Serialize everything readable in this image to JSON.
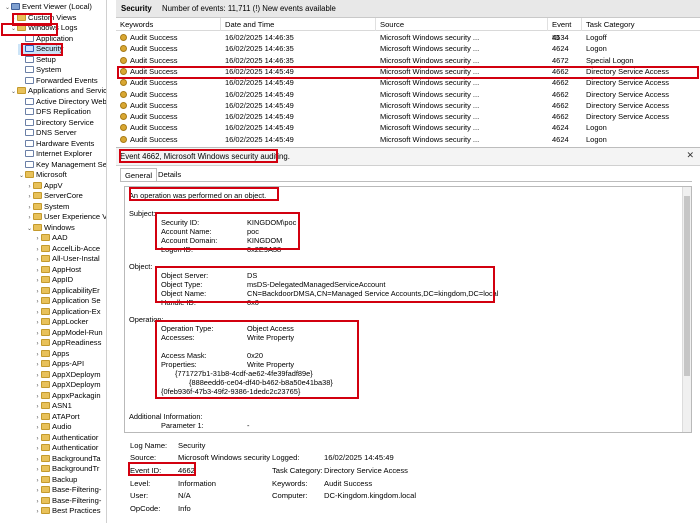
{
  "tree": {
    "items": [
      {
        "label": "Event Viewer (Local)",
        "icon": "root",
        "depth": 0,
        "exp": "⌄"
      },
      {
        "label": "Custom Views",
        "icon": "folder",
        "depth": 1,
        "exp": "›"
      },
      {
        "label": "Windows Logs",
        "icon": "folder",
        "depth": 1,
        "exp": "⌄"
      },
      {
        "label": "Application",
        "icon": "log",
        "depth": 2,
        "exp": ""
      },
      {
        "label": "Security",
        "icon": "logsel",
        "depth": 2,
        "exp": "",
        "selected": true
      },
      {
        "label": "Setup",
        "icon": "log",
        "depth": 2,
        "exp": ""
      },
      {
        "label": "System",
        "icon": "log",
        "depth": 2,
        "exp": ""
      },
      {
        "label": "Forwarded Events",
        "icon": "log",
        "depth": 2,
        "exp": ""
      },
      {
        "label": "Applications and Services Logs",
        "icon": "folder",
        "depth": 1,
        "exp": "⌄"
      },
      {
        "label": "Active Directory Web",
        "icon": "log",
        "depth": 2,
        "exp": ""
      },
      {
        "label": "DFS Replication",
        "icon": "log",
        "depth": 2,
        "exp": ""
      },
      {
        "label": "Directory Service",
        "icon": "log",
        "depth": 2,
        "exp": ""
      },
      {
        "label": "DNS Server",
        "icon": "log",
        "depth": 2,
        "exp": ""
      },
      {
        "label": "Hardware Events",
        "icon": "log",
        "depth": 2,
        "exp": ""
      },
      {
        "label": "Internet Explorer",
        "icon": "log",
        "depth": 2,
        "exp": ""
      },
      {
        "label": "Key Management Ser",
        "icon": "log",
        "depth": 2,
        "exp": ""
      },
      {
        "label": "Microsoft",
        "icon": "folder",
        "depth": 2,
        "exp": "⌄"
      },
      {
        "label": "AppV",
        "icon": "folder",
        "depth": 3,
        "exp": "›"
      },
      {
        "label": "ServerCore",
        "icon": "folder",
        "depth": 3,
        "exp": "›"
      },
      {
        "label": "System",
        "icon": "folder",
        "depth": 3,
        "exp": "›"
      },
      {
        "label": "User Experience Vi",
        "icon": "folder",
        "depth": 3,
        "exp": "›"
      },
      {
        "label": "Windows",
        "icon": "folder",
        "depth": 3,
        "exp": "⌄"
      },
      {
        "label": "AAD",
        "icon": "folder",
        "depth": 4,
        "exp": "›"
      },
      {
        "label": "AccelLib-Acce",
        "icon": "folder",
        "depth": 4,
        "exp": "›"
      },
      {
        "label": "All-User-Instal",
        "icon": "folder",
        "depth": 4,
        "exp": "›"
      },
      {
        "label": "AppHost",
        "icon": "folder",
        "depth": 4,
        "exp": "›"
      },
      {
        "label": "AppID",
        "icon": "folder",
        "depth": 4,
        "exp": "›"
      },
      {
        "label": "ApplicabilityEr",
        "icon": "folder",
        "depth": 4,
        "exp": "›"
      },
      {
        "label": "Application Se",
        "icon": "folder",
        "depth": 4,
        "exp": "›"
      },
      {
        "label": "Application-Ex",
        "icon": "folder",
        "depth": 4,
        "exp": "›"
      },
      {
        "label": "AppLocker",
        "icon": "folder",
        "depth": 4,
        "exp": "›"
      },
      {
        "label": "AppModel-Run",
        "icon": "folder",
        "depth": 4,
        "exp": "›"
      },
      {
        "label": "AppReadiness",
        "icon": "folder",
        "depth": 4,
        "exp": "›"
      },
      {
        "label": "Apps",
        "icon": "folder",
        "depth": 4,
        "exp": "›"
      },
      {
        "label": "Apps-API",
        "icon": "folder",
        "depth": 4,
        "exp": "›"
      },
      {
        "label": "AppXDeploym",
        "icon": "folder",
        "depth": 4,
        "exp": "›"
      },
      {
        "label": "AppXDeploym",
        "icon": "folder",
        "depth": 4,
        "exp": "›"
      },
      {
        "label": "AppxPackagin",
        "icon": "folder",
        "depth": 4,
        "exp": "›"
      },
      {
        "label": "ASN1",
        "icon": "folder",
        "depth": 4,
        "exp": "›"
      },
      {
        "label": "ATAPort",
        "icon": "folder",
        "depth": 4,
        "exp": "›"
      },
      {
        "label": "Audio",
        "icon": "folder",
        "depth": 4,
        "exp": "›"
      },
      {
        "label": "Authenticatior",
        "icon": "folder",
        "depth": 4,
        "exp": "›"
      },
      {
        "label": "Authenticatior",
        "icon": "folder",
        "depth": 4,
        "exp": "›"
      },
      {
        "label": "BackgroundTa",
        "icon": "folder",
        "depth": 4,
        "exp": "›"
      },
      {
        "label": "BackgroundTr",
        "icon": "folder",
        "depth": 4,
        "exp": "›"
      },
      {
        "label": "Backup",
        "icon": "folder",
        "depth": 4,
        "exp": "›"
      },
      {
        "label": "Base-Filtering-",
        "icon": "folder",
        "depth": 4,
        "exp": "›"
      },
      {
        "label": "Base-Filtering-",
        "icon": "folder",
        "depth": 4,
        "exp": "›"
      },
      {
        "label": "Best Practices",
        "icon": "folder",
        "depth": 4,
        "exp": "›"
      }
    ]
  },
  "list": {
    "header_title": "Security",
    "header_info": "Number of events: 11,711 (!) New events available",
    "columns": [
      "Keywords",
      "Date and Time",
      "Source",
      "Event ID",
      "Task Category"
    ],
    "rows": [
      [
        "Audit Success",
        "16/02/2025 14:46:35",
        "Microsoft Windows security ...",
        "4634",
        "Logoff"
      ],
      [
        "Audit Success",
        "16/02/2025 14:46:35",
        "Microsoft Windows security ...",
        "4624",
        "Logon"
      ],
      [
        "Audit Success",
        "16/02/2025 14:46:35",
        "Microsoft Windows security ...",
        "4672",
        "Special Logon"
      ],
      [
        "Audit Success",
        "16/02/2025 14:45:49",
        "Microsoft Windows security ...",
        "4662",
        "Directory Service Access"
      ],
      [
        "Audit Success",
        "16/02/2025 14:45:49",
        "Microsoft Windows security ...",
        "4662",
        "Directory Service Access"
      ],
      [
        "Audit Success",
        "16/02/2025 14:45:49",
        "Microsoft Windows security ...",
        "4662",
        "Directory Service Access"
      ],
      [
        "Audit Success",
        "16/02/2025 14:45:49",
        "Microsoft Windows security ...",
        "4662",
        "Directory Service Access"
      ],
      [
        "Audit Success",
        "16/02/2025 14:45:49",
        "Microsoft Windows security ...",
        "4662",
        "Directory Service Access"
      ],
      [
        "Audit Success",
        "16/02/2025 14:45:49",
        "Microsoft Windows security ...",
        "4624",
        "Logon"
      ],
      [
        "Audit Success",
        "16/02/2025 14:45:49",
        "Microsoft Windows security ...",
        "4624",
        "Logon"
      ],
      [
        "Audit Success",
        "16/02/2025 14:45:49",
        "Microsoft Windows security ...",
        "4769",
        "Kerberos Service Ticket Operat"
      ]
    ]
  },
  "detail": {
    "title": "Event 4662, Microsoft Windows security auditing.",
    "close": "✕",
    "tabs": [
      "General",
      "Details"
    ],
    "message": {
      "intro": "An operation was performed on an object.",
      "subject_header": "Subject:",
      "subject": [
        [
          "Security ID:",
          "KINGDOM\\poc"
        ],
        [
          "Account Name:",
          "poc"
        ],
        [
          "Account Domain:",
          "KINGDOM"
        ],
        [
          "Logon ID:",
          "0x2E9A38"
        ]
      ],
      "object_header": "Object:",
      "object": [
        [
          "Object Server:",
          "DS"
        ],
        [
          "Object Type:",
          "msDS-DelegatedManagedServiceAccount"
        ],
        [
          "Object Name:",
          "CN=BackdoorDMSA,CN=Managed Service Accounts,DC=kingdom,DC=local"
        ],
        [
          "Handle ID:",
          "0x0"
        ]
      ],
      "operation_header": "Operation:",
      "operation": [
        [
          "Operation Type:",
          "Object Access"
        ],
        [
          "Accesses:",
          "Write Property"
        ]
      ],
      "access_mask_label": "Access Mask:",
      "access_mask": "0x20",
      "properties_label": "Properties:",
      "properties": [
        "Write Property",
        "{771727b1-31b8-4cdf-ae62-4fe39fadf89e}",
        "{888eedd6-ce04-df40-b462-b8a50e41ba38}",
        "{0feb936f-47b3-49f2-9386-1dedc2c23765}"
      ],
      "additional_header": "Additional Information:",
      "parameter_label": "Parameter 1:",
      "parameter_value": "-"
    },
    "fields": {
      "log_name_label": "Log Name:",
      "log_name": "Security",
      "source_label": "Source:",
      "source": "Microsoft Windows security",
      "logged_label": "Logged:",
      "logged": "16/02/2025 14:45:49",
      "event_id_label": "Event ID:",
      "event_id": "4662",
      "task_label": "Task Category:",
      "task": "Directory Service Access",
      "level_label": "Level:",
      "level": "Information",
      "keywords_label": "Keywords:",
      "keywords": "Audit Success",
      "user_label": "User:",
      "user": "N/A",
      "computer_label": "Computer:",
      "computer": "DC-Kingdom.kingdom.local",
      "opcode_label": "OpCode:",
      "opcode": "Info"
    }
  },
  "colors": {
    "highlight": "#d2000f",
    "selection": "#cce4f7"
  }
}
